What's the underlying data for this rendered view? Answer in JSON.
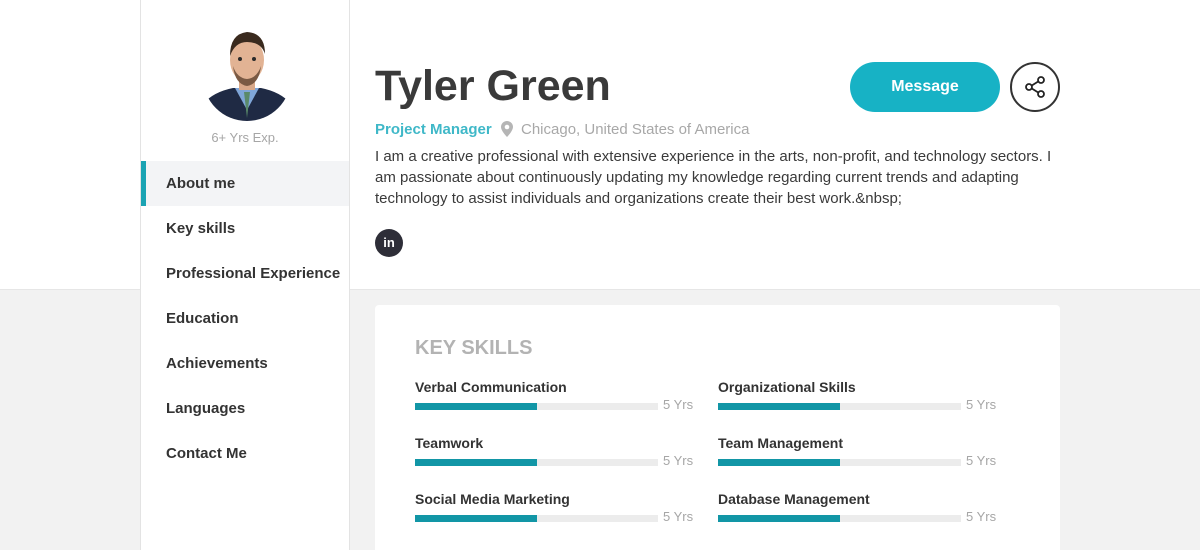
{
  "profile": {
    "experience": "6+ Yrs Exp.",
    "name": "Tyler Green",
    "role": "Project Manager",
    "location": "Chicago, United States of America",
    "about": "I am a creative professional with extensive experience in the arts, non-profit, and technology sectors. I am passionate about continuously updating my knowledge regarding current trends and adapting technology to assist individuals and organizations create their best work.&nbsp;",
    "linkedin_label": "in"
  },
  "actions": {
    "message_label": "Message",
    "share_icon": "share-icon"
  },
  "nav": {
    "items": [
      {
        "label": "About me",
        "active": true
      },
      {
        "label": "Key skills"
      },
      {
        "label": "Professional Experience"
      },
      {
        "label": "Education"
      },
      {
        "label": "Achievements"
      },
      {
        "label": "Languages"
      },
      {
        "label": "Contact Me"
      }
    ]
  },
  "key_skills": {
    "title": "KEY SKILLS",
    "items": [
      {
        "name": "Verbal Communication",
        "years": "5 Yrs",
        "level": 0.5
      },
      {
        "name": "Organizational Skills",
        "years": "5 Yrs",
        "level": 0.5
      },
      {
        "name": "Teamwork",
        "years": "5 Yrs",
        "level": 0.5
      },
      {
        "name": "Team Management",
        "years": "5 Yrs",
        "level": 0.5
      },
      {
        "name": "Social Media Marketing",
        "years": "5 Yrs",
        "level": 0.5
      },
      {
        "name": "Database Management",
        "years": "5 Yrs",
        "level": 0.5
      }
    ]
  },
  "colors": {
    "accent": "#17b2c5",
    "bar_fill": "#1296a6",
    "role_text": "#3fb8c8"
  }
}
